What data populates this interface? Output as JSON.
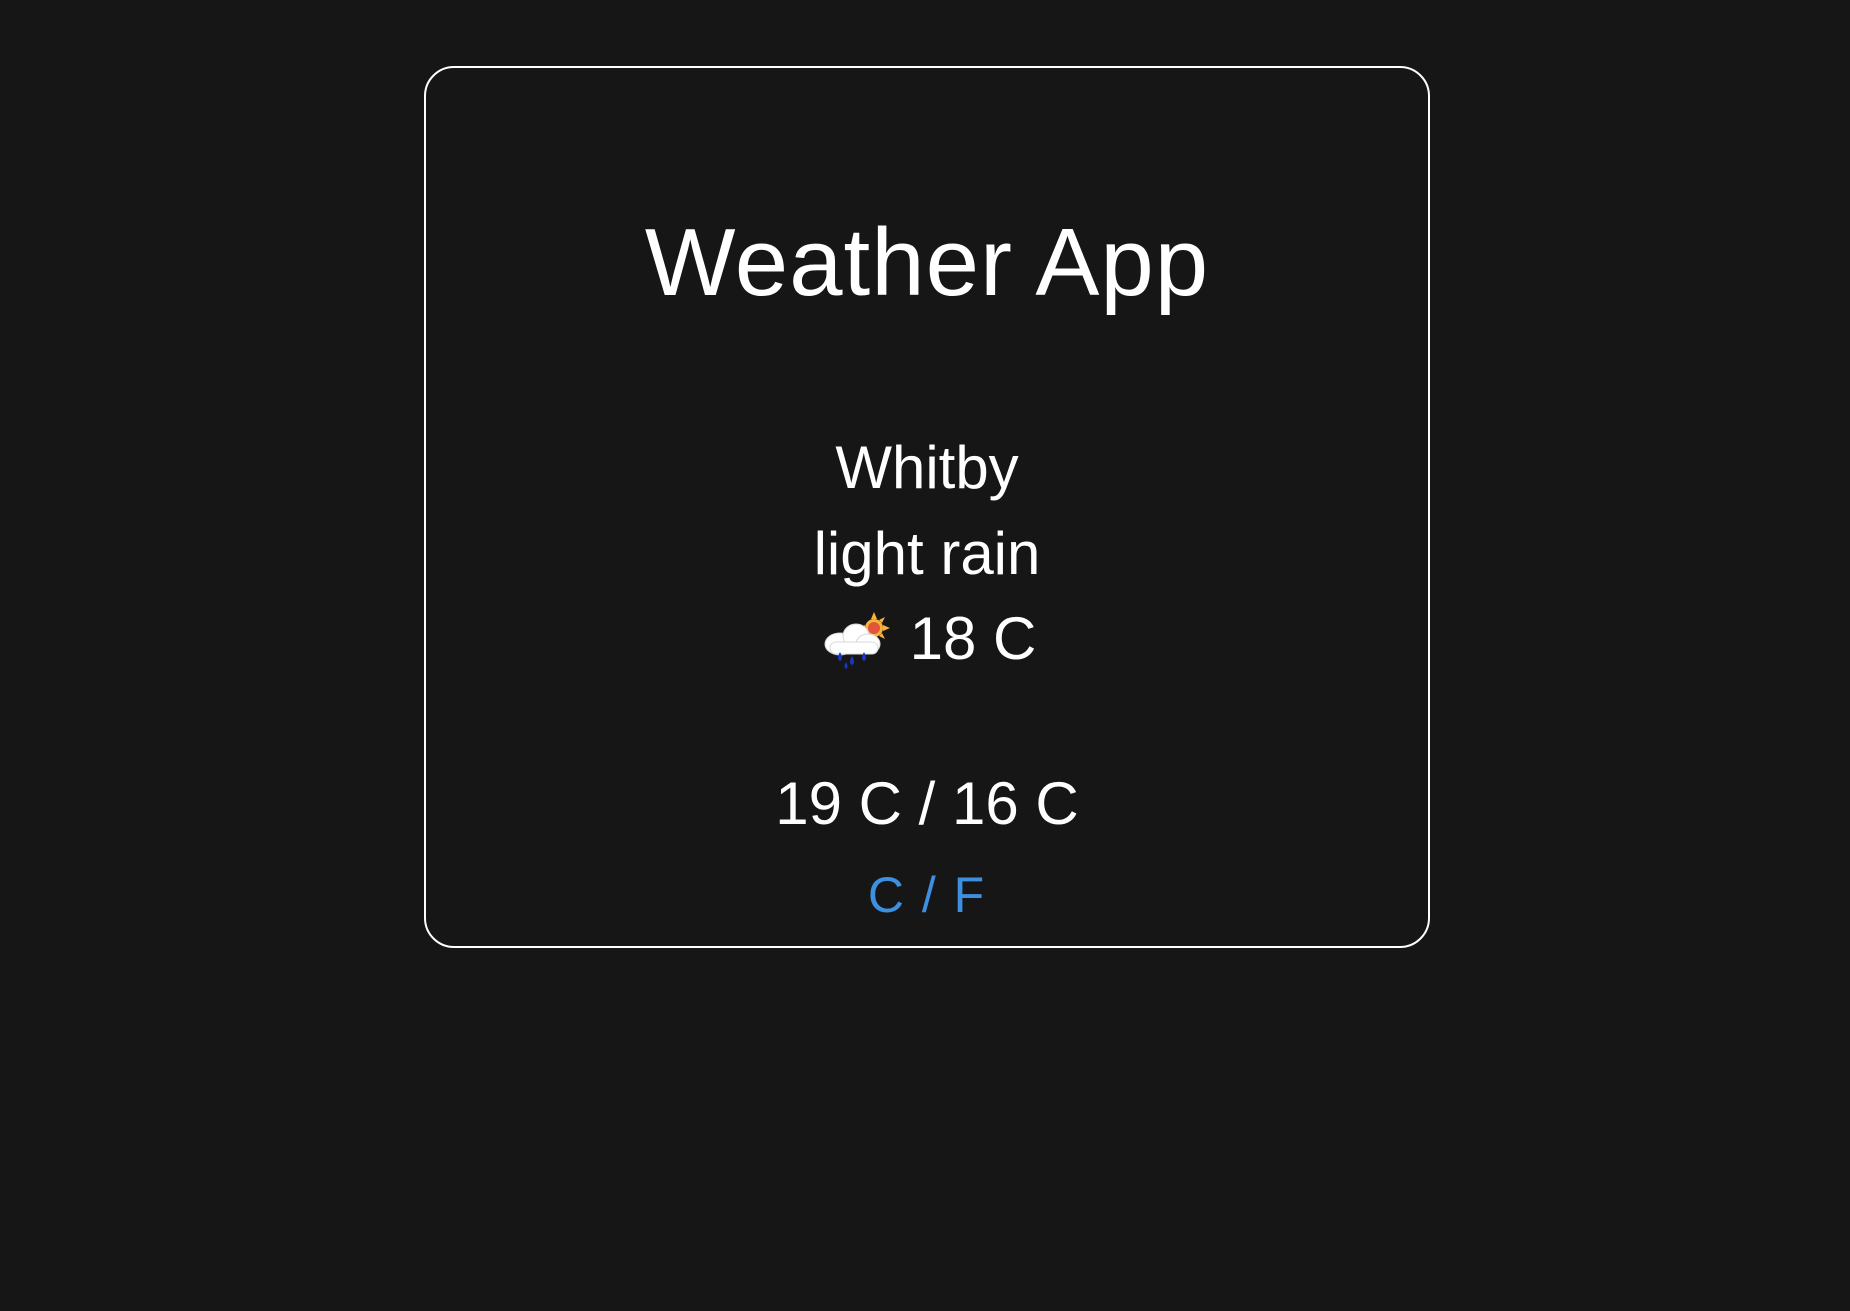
{
  "app": {
    "title": "Weather App"
  },
  "weather": {
    "city": "Whitby",
    "description": "light rain",
    "icon": "light-rain-sun-icon",
    "current_temp": "18 C",
    "high_low": "19 C / 16 C"
  },
  "unit_toggle": {
    "label": "C / F"
  },
  "colors": {
    "background": "#161616",
    "text": "#ffffff",
    "link": "#3d8fe0",
    "border": "#ffffff"
  }
}
